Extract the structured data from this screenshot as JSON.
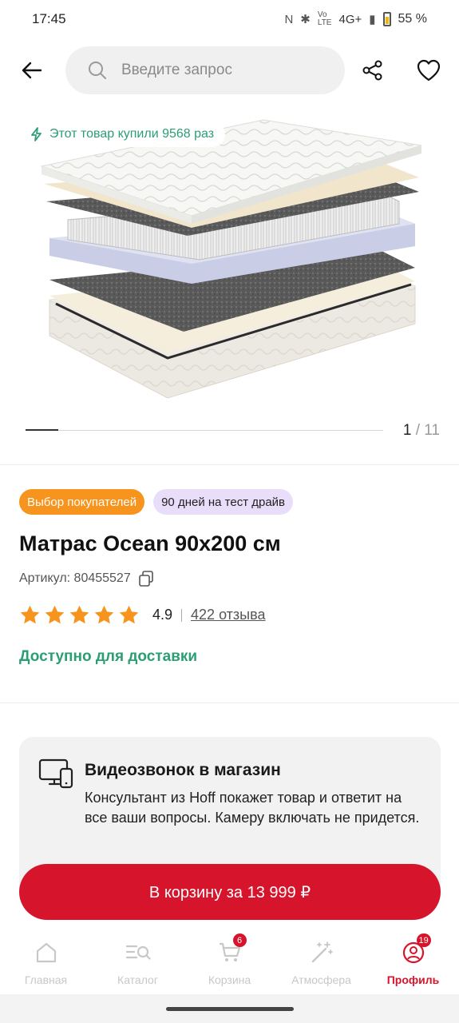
{
  "status_bar": {
    "time": "17:45",
    "network": "4G+",
    "battery": "55 %"
  },
  "search": {
    "placeholder": "Введите запрос"
  },
  "gallery": {
    "purchase_badge": "Этот товар купили 9568 раз",
    "current": "1",
    "separator": "/",
    "total": "11"
  },
  "product": {
    "tags": [
      "Выбор покупателей",
      "90 дней на тест драйв"
    ],
    "title": "Матрас Ocean 90x200 см",
    "sku": "Артикул: 80455527",
    "rating": "4.9",
    "stars": 5,
    "reviews": "422 отзыва",
    "availability": "Доступно для доставки"
  },
  "video_call": {
    "title": "Видеозвонок в магазин",
    "text": "Консультант из Hoff покажет товар и ответит на все ваши вопросы. Камеру включать не придется."
  },
  "cart_button": {
    "label": "В корзину за 13 999 ₽"
  },
  "bottom_nav": {
    "items": [
      {
        "label": "Главная",
        "icon": "home-icon"
      },
      {
        "label": "Каталог",
        "icon": "catalog-search-icon"
      },
      {
        "label": "Корзина",
        "icon": "cart-icon",
        "badge": "6"
      },
      {
        "label": "Атмосфера",
        "icon": "magic-wand-icon"
      },
      {
        "label": "Профиль",
        "icon": "profile-icon",
        "badge": "19",
        "active": true
      }
    ]
  },
  "colors": {
    "accent_red": "#d6142b",
    "green": "#2b9e74",
    "orange": "#f7941d",
    "lilac": "#e8defa"
  }
}
